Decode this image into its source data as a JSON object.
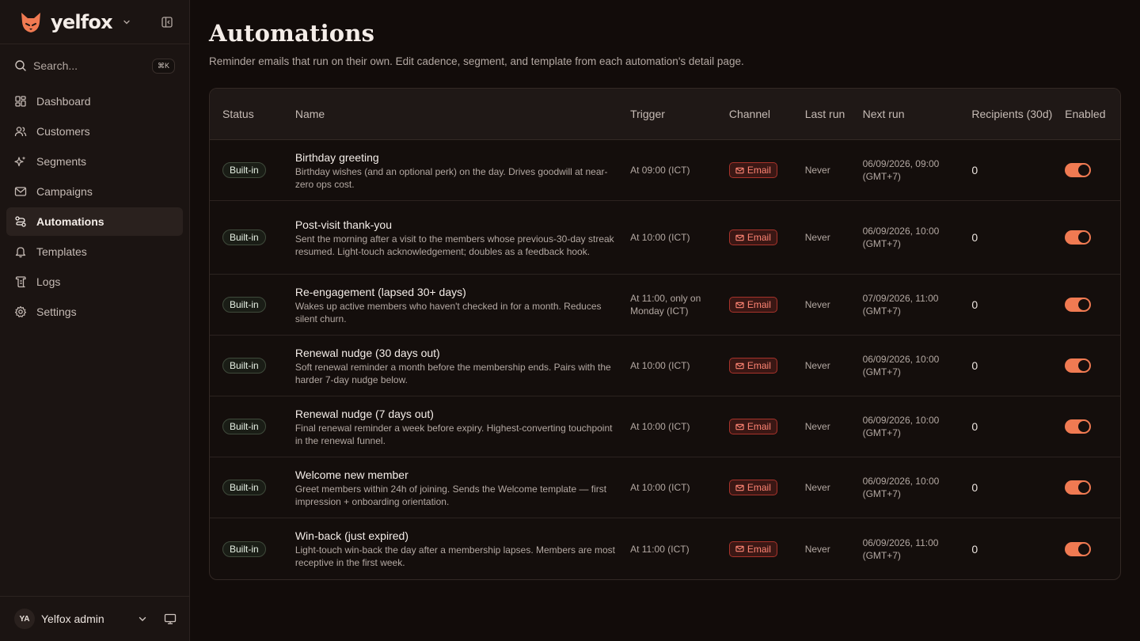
{
  "brand": {
    "name": "yelfox"
  },
  "search": {
    "label": "Search...",
    "shortcut": "⌘K"
  },
  "nav": [
    {
      "label": "Dashboard",
      "icon": "dashboard-icon",
      "active": false
    },
    {
      "label": "Customers",
      "icon": "users-icon",
      "active": false
    },
    {
      "label": "Segments",
      "icon": "sparkles-icon",
      "active": false
    },
    {
      "label": "Campaigns",
      "icon": "mail-icon",
      "active": false
    },
    {
      "label": "Automations",
      "icon": "route-icon",
      "active": true
    },
    {
      "label": "Templates",
      "icon": "bell-icon",
      "active": false
    },
    {
      "label": "Logs",
      "icon": "scroll-icon",
      "active": false
    },
    {
      "label": "Settings",
      "icon": "gear-icon",
      "active": false
    }
  ],
  "user": {
    "initials": "YA",
    "name": "Yelfox admin"
  },
  "page": {
    "title": "Automations",
    "subtitle": "Reminder emails that run on their own. Edit cadence, segment, and template from each automation's detail page."
  },
  "table": {
    "headers": {
      "status": "Status",
      "name": "Name",
      "trigger": "Trigger",
      "channel": "Channel",
      "last_run": "Last run",
      "next_run": "Next run",
      "recipients": "Recipients (30d)",
      "enabled": "Enabled"
    },
    "rows": [
      {
        "status": "Built-in",
        "name": "Birthday greeting",
        "description": "Birthday wishes (and an optional perk) on the day. Drives goodwill at near-zero ops cost.",
        "trigger": "At 09:00 (ICT)",
        "channel": "Email",
        "last_run": "Never",
        "next_run": "06/09/2026, 09:00 (GMT+7)",
        "recipients": "0",
        "enabled": true
      },
      {
        "status": "Built-in",
        "name": "Post-visit thank-you",
        "description": "Sent the morning after a visit to the members whose previous-30-day streak resumed. Light-touch acknowledgement; doubles as a feedback hook.",
        "trigger": "At 10:00 (ICT)",
        "channel": "Email",
        "last_run": "Never",
        "next_run": "06/09/2026, 10:00 (GMT+7)",
        "recipients": "0",
        "enabled": true
      },
      {
        "status": "Built-in",
        "name": "Re-engagement (lapsed 30+ days)",
        "description": "Wakes up active members who haven't checked in for a month. Reduces silent churn.",
        "trigger": "At 11:00, only on Monday (ICT)",
        "channel": "Email",
        "last_run": "Never",
        "next_run": "07/09/2026, 11:00 (GMT+7)",
        "recipients": "0",
        "enabled": true
      },
      {
        "status": "Built-in",
        "name": "Renewal nudge (30 days out)",
        "description": "Soft renewal reminder a month before the membership ends. Pairs with the harder 7-day nudge below.",
        "trigger": "At 10:00 (ICT)",
        "channel": "Email",
        "last_run": "Never",
        "next_run": "06/09/2026, 10:00 (GMT+7)",
        "recipients": "0",
        "enabled": true
      },
      {
        "status": "Built-in",
        "name": "Renewal nudge (7 days out)",
        "description": "Final renewal reminder a week before expiry. Highest-converting touchpoint in the renewal funnel.",
        "trigger": "At 10:00 (ICT)",
        "channel": "Email",
        "last_run": "Never",
        "next_run": "06/09/2026, 10:00 (GMT+7)",
        "recipients": "0",
        "enabled": true
      },
      {
        "status": "Built-in",
        "name": "Welcome new member",
        "description": "Greet members within 24h of joining. Sends the Welcome template — first impression + onboarding orientation.",
        "trigger": "At 10:00 (ICT)",
        "channel": "Email",
        "last_run": "Never",
        "next_run": "06/09/2026, 10:00 (GMT+7)",
        "recipients": "0",
        "enabled": true
      },
      {
        "status": "Built-in",
        "name": "Win-back (just expired)",
        "description": "Light-touch win-back the day after a membership lapses. Members are most receptive in the first week.",
        "trigger": "At 11:00 (ICT)",
        "channel": "Email",
        "last_run": "Never",
        "next_run": "06/09/2026, 11:00 (GMT+7)",
        "recipients": "0",
        "enabled": true
      }
    ]
  },
  "colors": {
    "accent": "#f07a52",
    "background": "#120c0a",
    "sidebar": "#1b1412",
    "email_badge": "#ff8574"
  }
}
